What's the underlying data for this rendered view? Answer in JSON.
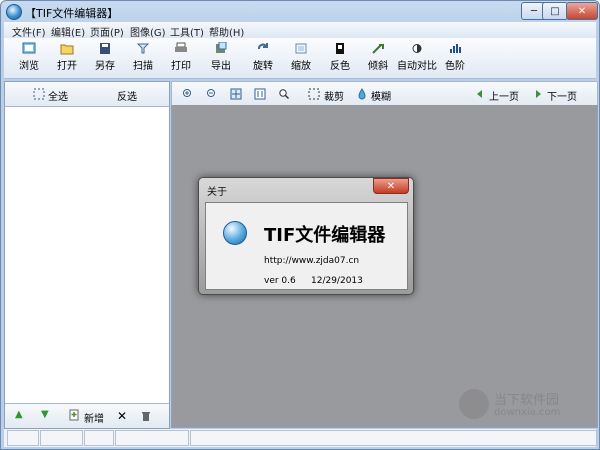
{
  "window": {
    "title": "【TIF文件编辑器】",
    "controls": [
      "─",
      "□",
      "✕"
    ]
  },
  "menu": [
    "文件(F)",
    "编辑(E)",
    "页面(P)",
    "图像(G)",
    "工具(T)",
    "帮助(H)"
  ],
  "toolbar": [
    {
      "label": "浏览",
      "icon": "browse-icon"
    },
    {
      "label": "打开",
      "icon": "open-folder-icon"
    },
    {
      "label": "另存",
      "icon": "save-icon"
    },
    {
      "label": "扫描",
      "icon": "scan-icon"
    },
    {
      "label": "打印",
      "icon": "print-icon"
    },
    {
      "label": "导出",
      "icon": "export-icon"
    },
    {
      "label": "旋转",
      "icon": "rotate-icon"
    },
    {
      "label": "缩放",
      "icon": "zoom-icon"
    },
    {
      "label": "反色",
      "icon": "invert-icon"
    },
    {
      "label": "倾斜",
      "icon": "skew-icon"
    },
    {
      "label": "自动对比",
      "icon": "contrast-icon"
    },
    {
      "label": "色阶",
      "icon": "levels-icon"
    }
  ],
  "left_panel": {
    "select_all": "全选",
    "invert_selection": "反选",
    "footer": {
      "add_label": "新增"
    }
  },
  "viewer_tools": {
    "crop": "裁剪",
    "blur": "模糊",
    "prev_page": "上一页",
    "next_page": "下一页"
  },
  "about_dialog": {
    "title": "关于",
    "app_name": "TIF文件编辑器",
    "url": "http://www.zjda07.cn",
    "version": "ver 0.6",
    "date": "12/29/2013"
  },
  "watermark": {
    "text": "当下软件园",
    "sub": "downxia.com"
  },
  "colors": {
    "canvas": "#999a9d",
    "accent": "#3d8fd0",
    "close": "#c7442f"
  }
}
